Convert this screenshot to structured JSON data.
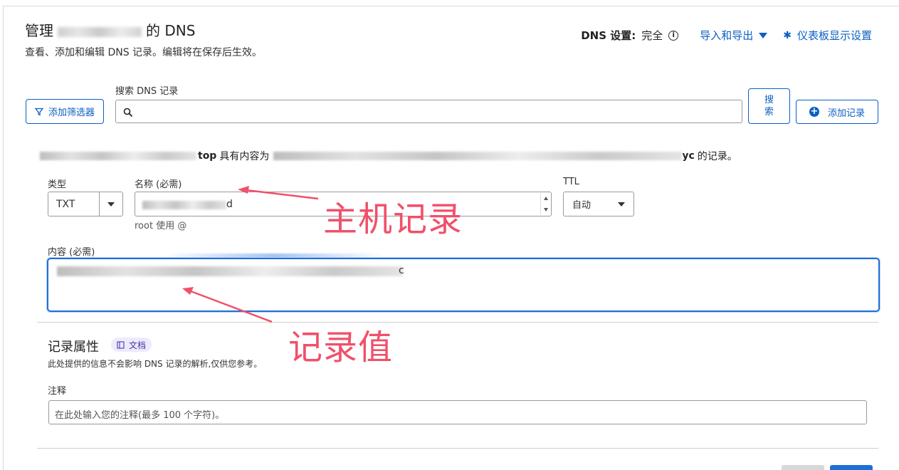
{
  "header": {
    "title_prefix": "管理",
    "title_suffix": "的 DNS",
    "subtitle": "查看、添加和编辑 DNS 记录。编辑将在保存后生效。",
    "dns_setting_label": "DNS 设置:",
    "dns_setting_value": "完全",
    "import_export": "导入和导出",
    "dashboard_settings": "仪表板显示设置"
  },
  "toolbar": {
    "filter_button": "添加筛选器",
    "search_label": "搜索 DNS 记录",
    "search_button": "搜\n索",
    "add_record_button": "添加记录"
  },
  "summary": {
    "domain_tail": "top",
    "text_mid": "具有内容为",
    "content_tail": "yc",
    "text_end": "的记录。"
  },
  "form": {
    "type_label": "类型",
    "type_value": "TXT",
    "name_label": "名称 (必需)",
    "name_value_tail": "d",
    "root_hint": "root 使用 @",
    "ttl_label": "TTL",
    "ttl_value": "自动",
    "content_label": "内容 (必需)",
    "content_value_tail": "c"
  },
  "attributes": {
    "title": "记录属性",
    "doc_chip": "文档",
    "description": "此处提供的信息不会影响 DNS 记录的解析,仅供您参考。",
    "note_label": "注释",
    "note_placeholder": "在此处输入您的注释(最多 100 个字符)。"
  },
  "annotations": {
    "host_record": "主机记录",
    "record_value": "记录值"
  },
  "colors": {
    "accent": "#0b5fc2",
    "annotation": "#f0506a"
  }
}
